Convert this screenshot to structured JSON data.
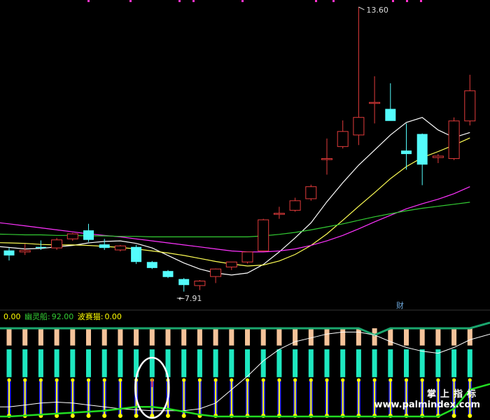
{
  "colors": {
    "up": "#e23b3b",
    "down": "#54fcfc",
    "ma_white": "#ffffff",
    "ma_yellow": "#ffff55",
    "ma_magenta": "#ff33ff",
    "ma_green": "#33cc33",
    "header_value": "#ffff00",
    "header_label_green": "#33cc33",
    "header_label_yellow": "#ffff00",
    "bar_top": "#f5c39a",
    "bar_mid": "#1ee8c0",
    "bar_bot_blue": "#2020ff",
    "dot_yellow": "#ffff00",
    "flag_pink": "#ff33cc",
    "axis_blue": "#6fa8dc"
  },
  "price_annotations": {
    "high_label": "13.60",
    "low_label": "7.91",
    "cai_badge": "财"
  },
  "indicator_header": {
    "value0": "0.00",
    "label1": "幽灵船:",
    "value1": "92.00",
    "label2": "波赛猫:",
    "value2": "0.00"
  },
  "watermark": {
    "title": "掌上指标",
    "url": "www.palmindex.com"
  },
  "chart_data": [
    {
      "type": "candlestick",
      "y_range": [
        7.91,
        13.6
      ],
      "candles": [
        {
          "o": 8.75,
          "h": 8.8,
          "l": 8.55,
          "c": 8.65
        },
        {
          "o": 8.72,
          "h": 8.88,
          "l": 8.66,
          "c": 8.75
        },
        {
          "o": 8.82,
          "h": 8.95,
          "l": 8.76,
          "c": 8.8
        },
        {
          "o": 8.8,
          "h": 9.0,
          "l": 8.76,
          "c": 8.96
        },
        {
          "o": 8.98,
          "h": 9.1,
          "l": 8.94,
          "c": 9.08
        },
        {
          "o": 9.15,
          "h": 9.28,
          "l": 8.92,
          "c": 8.96
        },
        {
          "o": 8.87,
          "h": 8.98,
          "l": 8.76,
          "c": 8.8
        },
        {
          "o": 8.76,
          "h": 8.86,
          "l": 8.73,
          "c": 8.84
        },
        {
          "o": 8.82,
          "h": 8.86,
          "l": 8.48,
          "c": 8.52
        },
        {
          "o": 8.52,
          "h": 8.54,
          "l": 8.38,
          "c": 8.4
        },
        {
          "o": 8.34,
          "h": 8.36,
          "l": 8.2,
          "c": 8.22
        },
        {
          "o": 8.18,
          "h": 8.2,
          "l": 7.93,
          "c": 8.06
        },
        {
          "o": 8.05,
          "h": 8.16,
          "l": 7.96,
          "c": 8.14
        },
        {
          "o": 8.23,
          "h": 8.39,
          "l": 8.1,
          "c": 8.38
        },
        {
          "o": 8.42,
          "h": 8.52,
          "l": 8.36,
          "c": 8.52
        },
        {
          "o": 8.52,
          "h": 8.72,
          "l": 8.49,
          "c": 8.72
        },
        {
          "o": 8.74,
          "h": 9.38,
          "l": 8.73,
          "c": 9.36
        },
        {
          "o": 9.48,
          "h": 9.62,
          "l": 9.38,
          "c": 9.49
        },
        {
          "o": 9.55,
          "h": 9.8,
          "l": 9.52,
          "c": 9.74
        },
        {
          "o": 9.78,
          "h": 10.06,
          "l": 9.74,
          "c": 10.02
        },
        {
          "o": 10.56,
          "h": 10.98,
          "l": 10.26,
          "c": 10.58
        },
        {
          "o": 10.82,
          "h": 11.34,
          "l": 10.78,
          "c": 11.12
        },
        {
          "o": 11.05,
          "h": 13.6,
          "l": 10.85,
          "c": 11.4
        },
        {
          "o": 11.68,
          "h": 12.22,
          "l": 11.28,
          "c": 11.7
        },
        {
          "o": 11.57,
          "h": 12.08,
          "l": 11.38,
          "c": 11.33
        },
        {
          "o": 10.74,
          "h": 11.28,
          "l": 10.36,
          "c": 10.67
        },
        {
          "o": 11.07,
          "h": 11.08,
          "l": 10.05,
          "c": 10.46
        },
        {
          "o": 10.6,
          "h": 10.67,
          "l": 10.49,
          "c": 10.63
        },
        {
          "o": 10.58,
          "h": 11.4,
          "l": 10.55,
          "c": 11.33
        },
        {
          "o": 11.33,
          "h": 12.25,
          "l": 11.24,
          "c": 11.93
        }
      ],
      "ma_lines": [
        {
          "name": "MA5",
          "color": "#ffffff",
          "values": [
            8.81,
            8.78,
            8.79,
            8.82,
            8.85,
            8.9,
            8.93,
            8.94,
            8.89,
            8.8,
            8.65,
            8.5,
            8.38,
            8.3,
            8.26,
            8.3,
            8.47,
            8.72,
            9.0,
            9.3,
            9.72,
            10.1,
            10.45,
            10.75,
            11.05,
            11.3,
            11.4,
            11.15,
            11.0,
            11.1
          ]
        },
        {
          "name": "MA10",
          "color": "#ffff55",
          "values": [
            8.9,
            8.89,
            8.87,
            8.86,
            8.86,
            8.85,
            8.83,
            8.81,
            8.78,
            8.74,
            8.7,
            8.65,
            8.59,
            8.53,
            8.48,
            8.44,
            8.46,
            8.54,
            8.67,
            8.85,
            9.08,
            9.35,
            9.63,
            9.9,
            10.18,
            10.42,
            10.6,
            10.72,
            10.85,
            10.99
          ]
        },
        {
          "name": "MA20",
          "color": "#ff33ff",
          "values": [
            9.28,
            9.24,
            9.2,
            9.16,
            9.12,
            9.08,
            9.05,
            9.02,
            8.98,
            8.94,
            8.9,
            8.86,
            8.82,
            8.78,
            8.74,
            8.72,
            8.72,
            8.74,
            8.78,
            8.85,
            8.94,
            9.05,
            9.18,
            9.32,
            9.45,
            9.58,
            9.68,
            9.77,
            9.88,
            10.02
          ]
        },
        {
          "name": "MA60",
          "color": "#33cc33",
          "values": [
            9.07,
            9.06,
            9.06,
            9.05,
            9.05,
            9.04,
            9.04,
            9.03,
            9.03,
            9.02,
            9.02,
            9.02,
            9.02,
            9.02,
            9.02,
            9.02,
            9.04,
            9.07,
            9.11,
            9.16,
            9.22,
            9.28,
            9.35,
            9.42,
            9.48,
            9.54,
            9.59,
            9.63,
            9.67,
            9.71
          ]
        }
      ]
    },
    {
      "type": "bar",
      "y_range": [
        0,
        100
      ],
      "bar_top": [
        92,
        92,
        92,
        92,
        92,
        92,
        92,
        92,
        92,
        92,
        92,
        92,
        92,
        92,
        92,
        92,
        92,
        92,
        92,
        92,
        92,
        92,
        92,
        92,
        92,
        92,
        92,
        92,
        92,
        92
      ],
      "bar_mid": [
        70,
        70,
        70,
        70,
        70,
        70,
        70,
        70,
        70,
        70,
        70,
        70,
        70,
        70,
        70,
        70,
        70,
        70,
        70,
        70,
        70,
        70,
        70,
        70,
        70,
        70,
        70,
        70,
        70,
        70
      ],
      "bar_blue": [
        38,
        38,
        38,
        38,
        38,
        38,
        38,
        38,
        38,
        38,
        38,
        38,
        38,
        38,
        38,
        38,
        38,
        38,
        38,
        38,
        38,
        38,
        38,
        38,
        38,
        38,
        38,
        38,
        38,
        38
      ],
      "bar_yellow": [
        38,
        38,
        38,
        38,
        38,
        38,
        38,
        38,
        38,
        38,
        38,
        38,
        38,
        38,
        38,
        38,
        38,
        38,
        38,
        38,
        38,
        38,
        38,
        38,
        38,
        38,
        38,
        38,
        38,
        38
      ],
      "green_line": [
        92,
        92,
        92,
        92,
        92,
        92,
        92,
        92,
        92,
        92,
        92,
        92,
        92,
        92,
        92,
        92,
        92,
        92,
        92,
        92,
        92,
        92,
        92,
        85,
        92,
        92,
        92,
        92,
        92,
        92
      ],
      "white_line": [
        10,
        12,
        14,
        15,
        14,
        12,
        10,
        8,
        7,
        6,
        6,
        6,
        8,
        14,
        28,
        42,
        58,
        70,
        78,
        82,
        86,
        88,
        88,
        85,
        78,
        72,
        68,
        66,
        72,
        80
      ],
      "green_lower": [
        0,
        1,
        2,
        3,
        4,
        5,
        6,
        8,
        10,
        10,
        8,
        5,
        2,
        0,
        0,
        0,
        0,
        0,
        0,
        0,
        0,
        0,
        0,
        0,
        0,
        0,
        0,
        0,
        8,
        28
      ],
      "flags": [
        9
      ],
      "circled": [
        9
      ]
    }
  ]
}
